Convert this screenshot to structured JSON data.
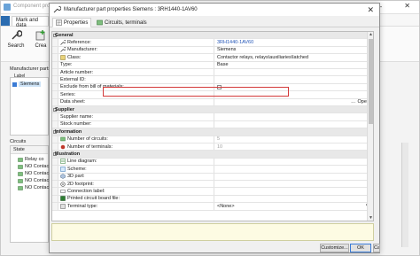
{
  "bg": {
    "title": "Component prope",
    "tab_file": "",
    "tab_mark": "Mark and data",
    "ribbon": [
      {
        "label": "Search",
        "icon": "wrench-icon"
      },
      {
        "label": "Crea",
        "icon": "create-icon"
      }
    ],
    "manufacturer_parts_label": "Manufacturer parts",
    "tree_label": "Label",
    "tree_item": "Siemens",
    "circuits_label": "Circuits",
    "circuits_state": "State",
    "circuits": [
      "Relay co",
      "NO Contac",
      "NO Contac",
      "NO Contac",
      "NO Contac"
    ]
  },
  "dialog": {
    "title": "Manufacturer part properties Siemens : 3RH1440-1AV60",
    "close": "✕",
    "tabs": [
      {
        "label": "Properties"
      },
      {
        "label": "Circuits, terminals"
      }
    ],
    "sections": {
      "general": "General",
      "supplier": "Supplier",
      "information": "Information",
      "illustration": "Illustration"
    },
    "rows": {
      "reference": {
        "name": "Reference:",
        "value": "3RH1440-1AV60"
      },
      "manufacturer": {
        "name": "Manufacturer:",
        "value": "Siemens"
      },
      "class": {
        "name": "Class:",
        "value": "Contactor relays, relays\\auxiliaries\\latched"
      },
      "type": {
        "name": "Type:",
        "value": "Base"
      },
      "article_number": {
        "name": "Article number:",
        "value": ""
      },
      "external_id": {
        "name": "External ID:",
        "value": ""
      },
      "exclude_bom": {
        "name": "Exclude from bill of materials:",
        "checked": false
      },
      "series": {
        "name": "Series:",
        "value": ""
      },
      "data_sheet": {
        "name": "Data sheet:",
        "value": "",
        "open": "Open"
      },
      "supplier_name": {
        "name": "Supplier name:",
        "value": ""
      },
      "stock_number": {
        "name": "Stock number:",
        "value": ""
      },
      "num_circuits": {
        "name": "Number of circuits:",
        "value": "5"
      },
      "num_terminals": {
        "name": "Number of terminals:",
        "value": "10"
      },
      "line_diagram": {
        "name": "Line diagram:",
        "value": ""
      },
      "scheme": {
        "name": "Scheme:",
        "value": ""
      },
      "part_3d": {
        "name": "3D part:",
        "value": ""
      },
      "footprint_2d": {
        "name": "2D footprint:",
        "value": ""
      },
      "connection_label": {
        "name": "Connection label:",
        "value": ""
      },
      "pcb_file": {
        "name": "Printed circuit board file:",
        "value": ""
      },
      "terminal_type": {
        "name": "Terminal type:",
        "value": "<None>"
      }
    },
    "buttons": {
      "customize": "Customize...",
      "ok": "OK",
      "cancel": "Cancel"
    }
  },
  "colors": {
    "highlight": "#d33a3a",
    "link": "#2456b8",
    "section_bg": "#e8e8e8"
  }
}
